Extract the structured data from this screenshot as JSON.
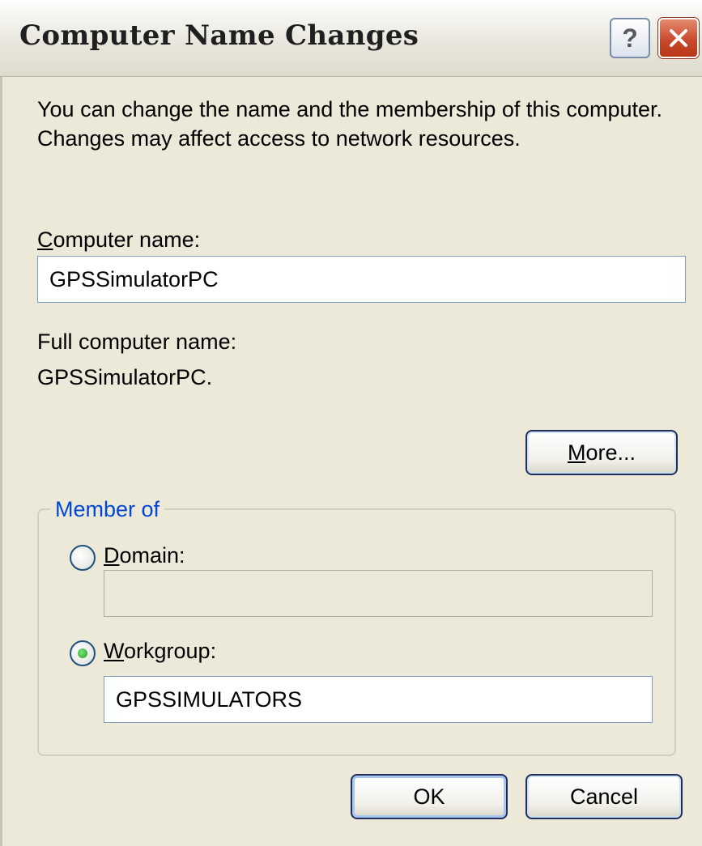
{
  "window": {
    "title": "Computer Name Changes",
    "help_label": "?"
  },
  "intro_text": "You can change the name and the membership of this computer. Changes may affect access to network resources.",
  "computer_name": {
    "label_accel": "C",
    "label_rest": "omputer name:",
    "value": "GPSSimulatorPC"
  },
  "full_name": {
    "label": "Full computer name:",
    "value": "GPSSimulatorPC."
  },
  "more_button": {
    "accel": "M",
    "rest": "ore..."
  },
  "member_of": {
    "legend": "Member of",
    "domain": {
      "accel": "D",
      "rest": "omain:",
      "value": "",
      "selected": false
    },
    "workgroup": {
      "accel": "W",
      "rest": "orkgroup:",
      "value": "GPSSIMULATORS",
      "selected": true
    }
  },
  "buttons": {
    "ok": "OK",
    "cancel": "Cancel"
  },
  "icons": {
    "close": "close-icon",
    "help": "help-icon"
  },
  "colors": {
    "dialog_bg": "#ECE9D8",
    "group_legend": "#0046D5",
    "close_red": "#C8462A"
  }
}
